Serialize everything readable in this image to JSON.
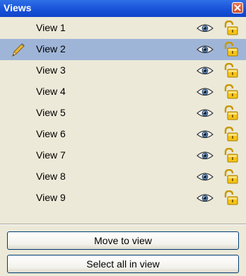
{
  "panel": {
    "title": "Views",
    "close_icon": "close-icon"
  },
  "views": [
    {
      "label": "View 1",
      "selected": false,
      "editing": false
    },
    {
      "label": "View 2",
      "selected": true,
      "editing": true
    },
    {
      "label": "View 3",
      "selected": false,
      "editing": false
    },
    {
      "label": "View 4",
      "selected": false,
      "editing": false
    },
    {
      "label": "View 5",
      "selected": false,
      "editing": false
    },
    {
      "label": "View 6",
      "selected": false,
      "editing": false
    },
    {
      "label": "View 7",
      "selected": false,
      "editing": false
    },
    {
      "label": "View 8",
      "selected": false,
      "editing": false
    },
    {
      "label": "View 9",
      "selected": false,
      "editing": false
    }
  ],
  "row_icons": {
    "visibility": "eye-icon",
    "lock": "padlock-icon",
    "edit": "pencil-icon"
  },
  "buttons": {
    "move_to_view": "Move to view",
    "select_all_in_view": "Select all in view"
  },
  "colors": {
    "titlebar": "#1650d8",
    "panel_bg": "#ece9d8",
    "selected_row": "#9fb5d8",
    "button_border": "#003c74"
  }
}
